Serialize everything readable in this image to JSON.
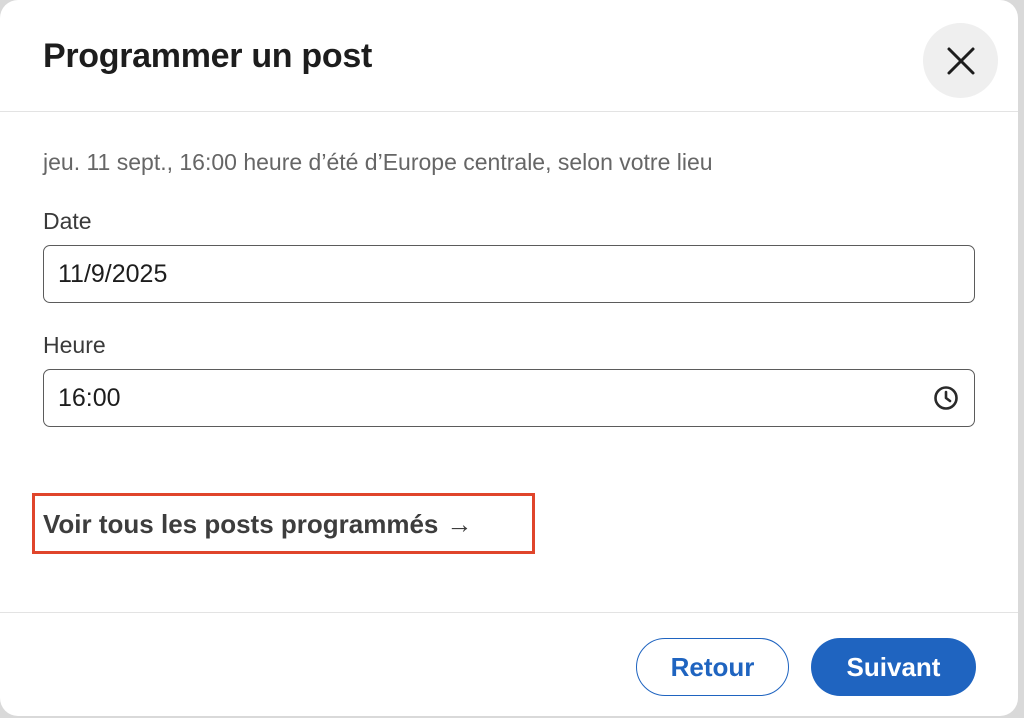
{
  "dialog": {
    "title": "Programmer un post",
    "close_icon": "close-icon"
  },
  "schedule": {
    "timezone_note": "jeu. 11 sept., 16:00 heure d’été d’Europe centrale, selon votre lieu",
    "date": {
      "label": "Date",
      "value": "11/9/2025"
    },
    "time": {
      "label": "Heure",
      "value": "16:00",
      "icon": "clock-icon"
    }
  },
  "links": {
    "view_scheduled": "Voir tous les posts programmés",
    "view_scheduled_arrow": "→"
  },
  "footer": {
    "back_label": "Retour",
    "next_label": "Suivant"
  },
  "colors": {
    "primary": "#1f64c0",
    "highlight": "#e0452b"
  }
}
